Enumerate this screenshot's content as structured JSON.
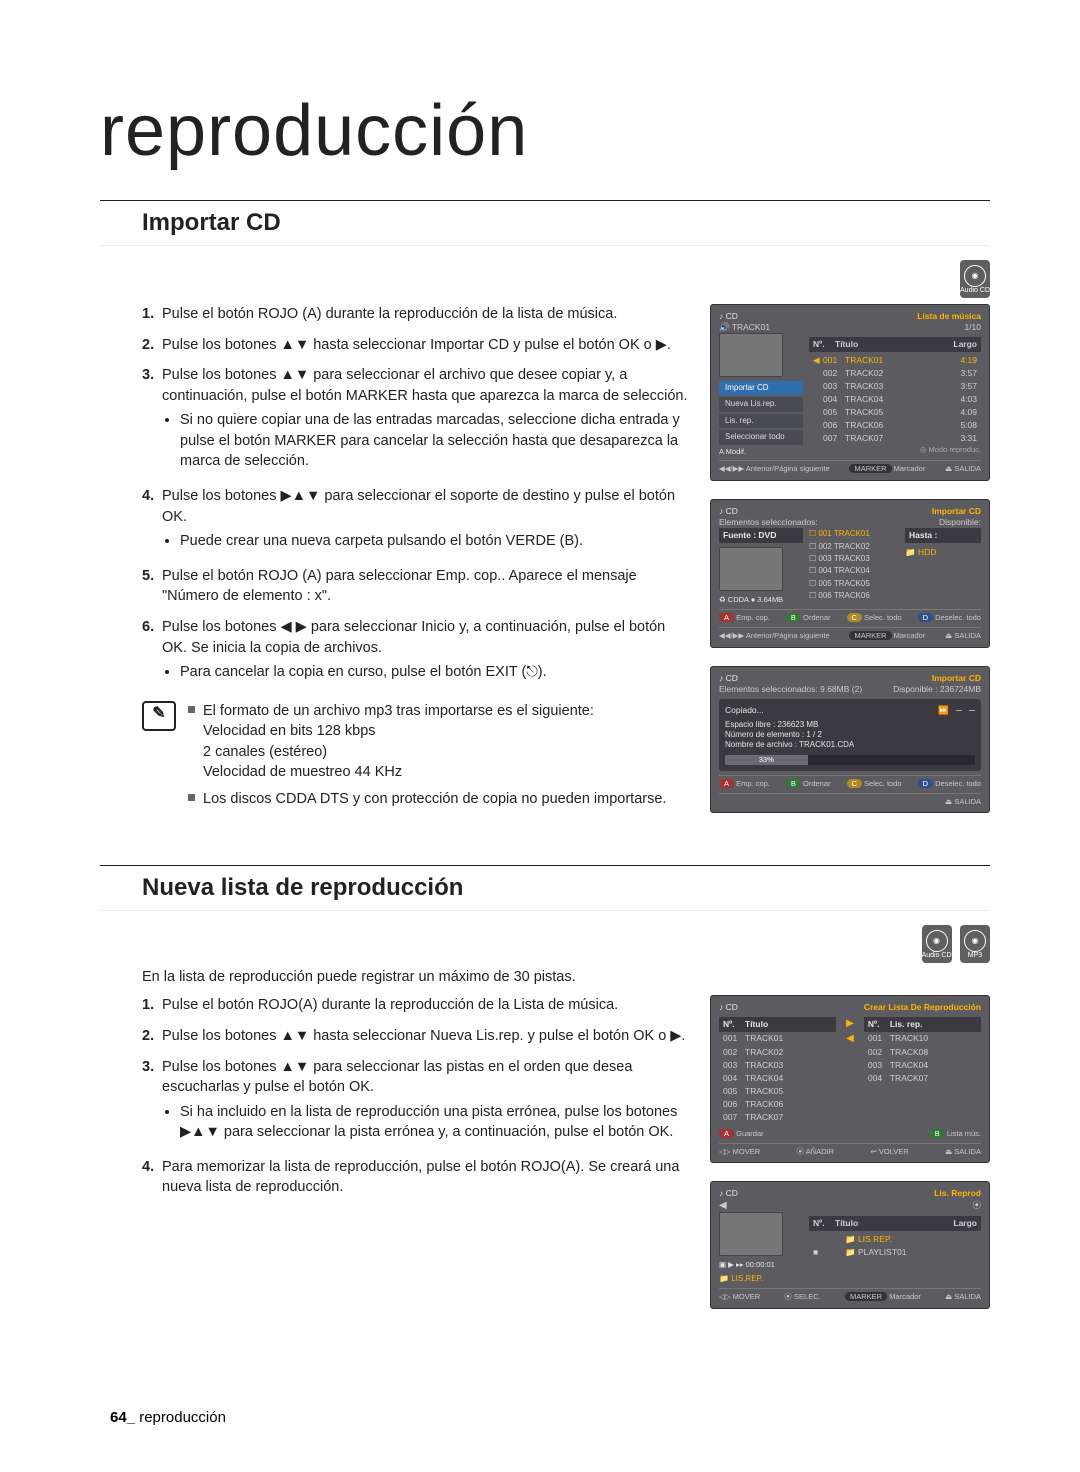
{
  "page_title": "reproducción",
  "page_footer": {
    "num": "64_",
    "label": "reproducción"
  },
  "badges": {
    "audio_cd": "Audio CD",
    "mp3": "MP3"
  },
  "sec1": {
    "title": "Importar CD",
    "steps": {
      "s1": "Pulse el botón ROJO (A) durante la reproducción de la lista de música.",
      "s2": "Pulse los botones ▲▼ hasta seleccionar Importar CD y pulse el botón OK o ▶.",
      "s3": "Pulse los botones ▲▼ para seleccionar el archivo que desee copiar y, a continuación, pulse el botón MARKER hasta que aparezca la marca de selección.",
      "s3a": "Si no quiere copiar una de las entradas marcadas, seleccione dicha entrada y pulse el botón MARKER para cancelar la selección hasta que desaparezca la marca de selección.",
      "s4": "Pulse los botones ▶▲▼ para seleccionar el soporte de destino y pulse el botón OK.",
      "s4a": "Puede crear una nueva carpeta pulsando el botón VERDE (B).",
      "s5": "Pulse el botón ROJO (A) para seleccionar Emp. cop.. Aparece el mensaje \"Número de elemento : x\".",
      "s6": "Pulse los botones ◀ ▶ para seleccionar Inicio y, a continuación, pulse el botón OK. Se inicia la copia de archivos.",
      "s6a": "Para cancelar la copia en curso, pulse el botón EXIT (⎋)."
    },
    "notes": {
      "n1": "El formato de un archivo mp3 tras importarse es el siguiente:\nVelocidad en bits 128 kbps\n2 canales (estéreo)\nVelocidad de muestreo 44 KHz",
      "n2": "Los discos CDDA DTS y con protección de copia no pueden importarse."
    }
  },
  "sec2": {
    "title": "Nueva lista de reproducción",
    "intro": "En la lista de reproducción puede registrar un máximo de 30 pistas.",
    "steps": {
      "s1": "Pulse el botón ROJO(A) durante la reproducción de la Lista de música.",
      "s2": "Pulse los botones ▲▼ hasta seleccionar Nueva Lis.rep. y pulse el botón OK o ▶.",
      "s3": "Pulse los botones ▲▼ para seleccionar las pistas en el orden que desea escucharlas y pulse el botón OK.",
      "s3a": "Si ha incluido en la lista de reproducción una pista errónea, pulse los botones ▶▲▼ para seleccionar la pista errónea y, a continuación, pulse el botón OK.",
      "s4": "Para memorizar la lista de reproducción, pulse el botón ROJO(A). Se creará una nueva lista de reproducción."
    }
  },
  "screens": {
    "sc1": {
      "media": "CD",
      "corner": "Lista de música",
      "playing": "TRACK01",
      "idx": "1/10",
      "cols": {
        "no": "Nº.",
        "title": "Título",
        "len": "Largo"
      },
      "tracks": [
        {
          "no": "001",
          "title": "TRACK01",
          "len": "4:19",
          "sel": true
        },
        {
          "no": "002",
          "title": "TRACK02",
          "len": "3:57"
        },
        {
          "no": "003",
          "title": "TRACK03",
          "len": "3:57"
        },
        {
          "no": "004",
          "title": "TRACK04",
          "len": "4:03"
        },
        {
          "no": "005",
          "title": "TRACK05",
          "len": "4:09"
        },
        {
          "no": "006",
          "title": "TRACK06",
          "len": "5:08"
        },
        {
          "no": "007",
          "title": "TRACK07",
          "len": "3:31"
        }
      ],
      "menu": [
        "Importar CD",
        "Nueva Lis.rep.",
        "Lis. rep.",
        "Seleccionar todo"
      ],
      "menu_sel": 0,
      "menu_foot": "A  Modif.",
      "footer": {
        "a": "Anterior/Página siguiente",
        "b": "Marcador",
        "c": "SALIDA",
        "d": "Modo reproduc."
      }
    },
    "sc2": {
      "media": "CD",
      "corner": "Importar CD",
      "left_label": "Elementos seleccionados:",
      "right_label": "Disponible:",
      "source": "Fuente : DVD",
      "dest": "Hasta :",
      "dest_item": "HDD",
      "size": "♻ CDDA   ● 3.64MB",
      "tracks": [
        {
          "no": "001",
          "title": "TRACK01",
          "sel": true
        },
        {
          "no": "002",
          "title": "TRACK02"
        },
        {
          "no": "003",
          "title": "TRACK03"
        },
        {
          "no": "004",
          "title": "TRACK04"
        },
        {
          "no": "005",
          "title": "TRACK05"
        },
        {
          "no": "006",
          "title": "TRACK06"
        }
      ],
      "footer": {
        "red": "Emp. cop.",
        "green": "Ordenar",
        "yellow": "Selec. todo",
        "blue": "Deselec. todo"
      },
      "footer2": {
        "a": "Anterior/Página siguiente",
        "b": "Marcador",
        "c": "SALIDA"
      }
    },
    "sc3": {
      "media": "CD",
      "corner": "Importar CD",
      "sel": "Elementos seleccionados: 9.68MB (2)",
      "avail": "Disponible : 236724MB",
      "copy": "Copiado...",
      "free": "Espacio libre : 236623 MB",
      "num": "Número de elemento : 1 / 2",
      "file": "Nombre de archivo : TRACK01.CDA",
      "pct": "33%",
      "footer": {
        "red": "Emp. cop.",
        "green": "Ordenar",
        "yellow": "Selec. todo",
        "blue": "Deselec. todo"
      },
      "footer_exit": "SALIDA"
    },
    "sc4": {
      "media": "CD",
      "corner": "Crear Lista De Reproducción",
      "left_head": {
        "no": "Nº.",
        "title": "Título"
      },
      "right_head": {
        "no": "Nº.",
        "title": "Lis. rep."
      },
      "left": [
        {
          "no": "001",
          "title": "TRACK01"
        },
        {
          "no": "002",
          "title": "TRACK02"
        },
        {
          "no": "003",
          "title": "TRACK03"
        },
        {
          "no": "004",
          "title": "TRACK04"
        },
        {
          "no": "005",
          "title": "TRACK05"
        },
        {
          "no": "006",
          "title": "TRACK06"
        },
        {
          "no": "007",
          "title": "TRACK07"
        }
      ],
      "right": [
        {
          "no": "001",
          "title": "TRACK10"
        },
        {
          "no": "002",
          "title": "TRACK08"
        },
        {
          "no": "003",
          "title": "TRACK04"
        },
        {
          "no": "004",
          "title": "TRACK07"
        }
      ],
      "footer": {
        "red": "Guardar",
        "green": "Lista mús."
      },
      "footer2": {
        "a": "MOVER",
        "b": "AÑADIR",
        "c": "VOLVER",
        "d": "SALIDA"
      }
    },
    "sc5": {
      "media": "CD",
      "corner": "Lis. Reprod",
      "cols": {
        "no": "Nº.",
        "title": "Título",
        "len": "Largo"
      },
      "folder1": "LIS.REP.",
      "folder2": "PLAYLIST01",
      "time": "00:00:01",
      "tag": "LIS.REP.",
      "footer": {
        "a": "MOVER",
        "b": "SELEC.",
        "c": "Marcador",
        "d": "SALIDA"
      }
    }
  }
}
